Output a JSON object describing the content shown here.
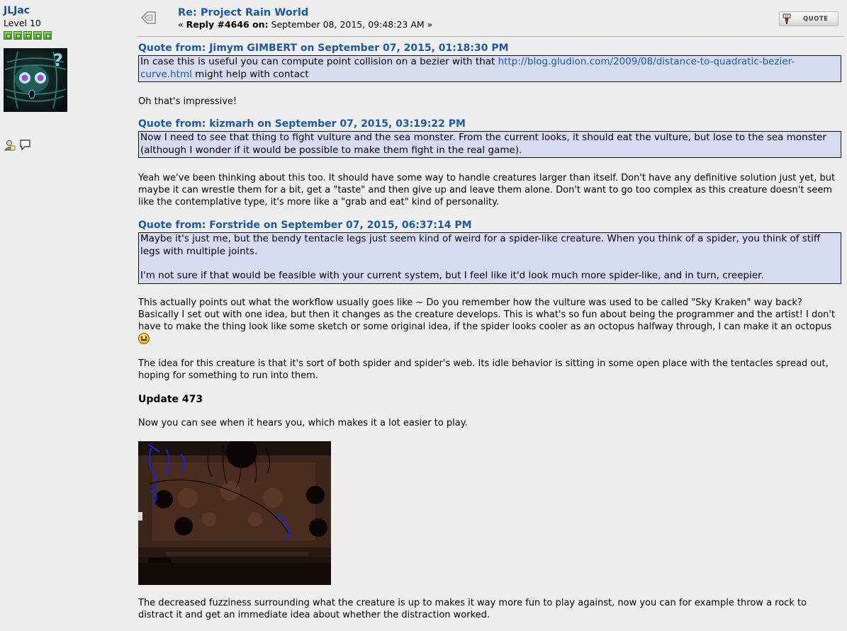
{
  "poster": {
    "username": "JLJac",
    "level": "Level 10",
    "star_count": 5
  },
  "post": {
    "subject": "Re: Project Rain World",
    "reply_prefix": "« ",
    "reply_label": "Reply #4646 on:",
    "reply_date": " September 08, 2015, 09:48:23 AM »",
    "quote_button": "QUOTE"
  },
  "body": {
    "quote1": {
      "header": "Quote from: Jimym GIMBERT on September 07, 2015, 01:18:30 PM",
      "text_before": "In case this is useful you can compute point collision on a bezier with that ",
      "link": "http://blog.gludion.com/2009/08/distance-to-quadratic-bezier-curve.html",
      "text_after": " might help with contact"
    },
    "reply1": "Oh that's impressive!",
    "quote2": {
      "header": "Quote from: kizmarh on September 07, 2015, 03:19:22 PM",
      "text": "Now I need to see that thing to fight vulture and the sea monster. From the current looks, it should eat the vulture, but lose to the sea monster (although I wonder if it would be possible to make them fight in the real game)."
    },
    "reply2": "Yeah we've been thinking about this too. It should have some way to handle creatures larger than itself. Don't have any definitive solution just yet, but maybe it can wrestle them for a bit, get a \"taste\" and then give up and leave them alone. Don't want to go too complex as this creature doesn't seem like the contemplative type, it's more like a \"grab and eat\" kind of personality.",
    "quote3": {
      "header": "Quote from: Forstride on September 07, 2015, 06:37:14 PM",
      "text1": "Maybe it's just me, but the bendy tentacle legs just seem kind of weird for a spider-like creature.  When you think of a spider, you think of stiff legs with multiple joints.",
      "text2": "I'm not sure if that would be feasible with your current system, but I feel like it'd look much more spider-like, and in turn, creepier."
    },
    "reply3": "This actually points out what the workflow usually goes like ~ Do you remember how the vulture was used to be called \"Sky Kraken\" way back? Basically I set out with one idea, but then it changes as the creature develops. This is what's so fun about being the programmer and the artist! I don't have to make the thing look like some sketch or some original idea, if the spider looks cooler as an octopus halfway through, I can make it an octopus ",
    "reply4": "The idea for this creature is that it's sort of both spider and spider's web. Its idle behavior is sitting in some open place with the tentacles spread out, hoping for something to run into them.",
    "update_title": "Update 473",
    "reply5": "Now you can see when it hears you, which makes it a lot easier to play.",
    "reply6": "The decreased fuzziness surrounding what the creature is up to makes it way more fun to play against, now you can for example throw a rock to distract it and get an immediate idea about whether the distraction worked."
  },
  "icons": {
    "post": "post-icon",
    "quote": "quote-icon",
    "profile": "profile-icon",
    "message": "pm-icon",
    "smiley": "smiley-icon"
  }
}
